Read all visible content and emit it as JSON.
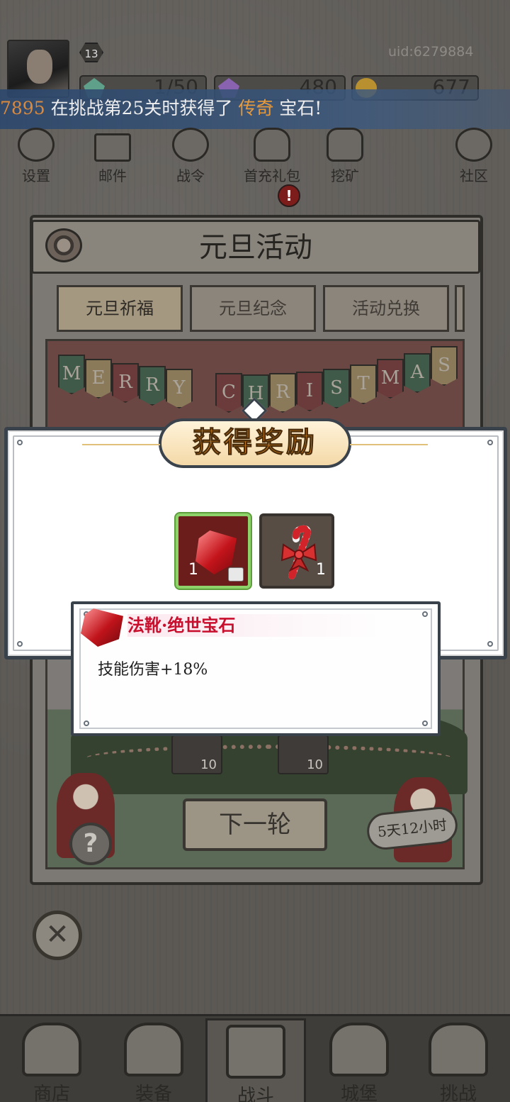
{
  "player": {
    "level": "13",
    "uid": "uid:6279884"
  },
  "resources": [
    {
      "name": "stamina",
      "value": "1/50",
      "color": "#5fa08a",
      "icon": "green-gem-icon"
    },
    {
      "name": "diamond",
      "value": "480",
      "color": "#8a63b0",
      "icon": "purple-diamond-icon"
    },
    {
      "name": "gold",
      "value": "677",
      "color": "#b8902f",
      "icon": "gold-coin-icon"
    }
  ],
  "broadcast": {
    "id": "7895",
    "text_before": " 在挑战第25关时获得了 ",
    "highlight": "传奇",
    "text_after": " 宝石!"
  },
  "top_icons": [
    {
      "label": "设置",
      "icon": "gear-icon"
    },
    {
      "label": "邮件",
      "icon": "mail-icon"
    },
    {
      "label": "战令",
      "icon": "battle-pass-icon"
    },
    {
      "label": "首充礼包",
      "icon": "gift-bag-icon"
    },
    {
      "label": "挖矿",
      "icon": "mining-icon"
    },
    {
      "label": "社区",
      "icon": "home-icon"
    }
  ],
  "alert_badge": "!",
  "event": {
    "title": "元旦活动",
    "tabs": [
      "元旦祈福",
      "元旦纪念",
      "活动兑换"
    ],
    "banner_letters": [
      "M",
      "E",
      "R",
      "R",
      "Y",
      "",
      "C",
      "H",
      "R",
      "I",
      "S",
      "T",
      "M",
      "A",
      "S"
    ],
    "gift_counts": [
      "10",
      "10"
    ],
    "help_symbol": "?",
    "next_button": "下一轮",
    "timer": "5天12小时"
  },
  "reward": {
    "title": "获得奖励",
    "items": [
      {
        "name": "ruby-gem",
        "count": "1"
      },
      {
        "name": "candy-cane",
        "count": "1"
      }
    ]
  },
  "tooltip": {
    "name": "法靴·绝世宝石",
    "description": "技能伤害+18%"
  },
  "close_symbol": "✕",
  "bottom_nav": [
    {
      "label": "商店",
      "icon": "shop-icon"
    },
    {
      "label": "装备",
      "icon": "backpack-icon"
    },
    {
      "label": "战斗",
      "icon": "crossed-swords-icon"
    },
    {
      "label": "城堡",
      "icon": "castle-icon"
    },
    {
      "label": "挑战",
      "icon": "challenge-shield-icon"
    }
  ],
  "colors": {
    "broadcast_highlight": "#e79a3b",
    "reward_title": "#e28a20",
    "tooltip_name": "#c8102e",
    "selected_border": "#8ed36a"
  }
}
